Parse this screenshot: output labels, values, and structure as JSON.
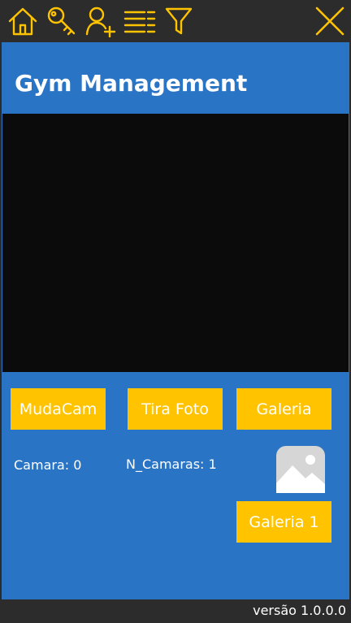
{
  "toolbar": {
    "icons": [
      "home-icon",
      "key-icon",
      "add-user-icon",
      "list-icon",
      "filter-icon",
      "close-icon"
    ],
    "accent": "#ffc300"
  },
  "header": {
    "title": "Gym Management"
  },
  "controls": {
    "mudacam_label": "MudaCam",
    "tirafoto_label": "Tira Foto",
    "galeria_label": "Galeria",
    "galeria1_label": "Galeria 1"
  },
  "status": {
    "camara": "Camara: 0",
    "n_camaras": "N_Camaras: 1"
  },
  "footer": {
    "version": "versão 1.0.0.0"
  },
  "colors": {
    "background": "#2a74c6",
    "toolbar": "#2c2c2c",
    "button": "#ffc300",
    "camera": "#0b0b0b"
  }
}
